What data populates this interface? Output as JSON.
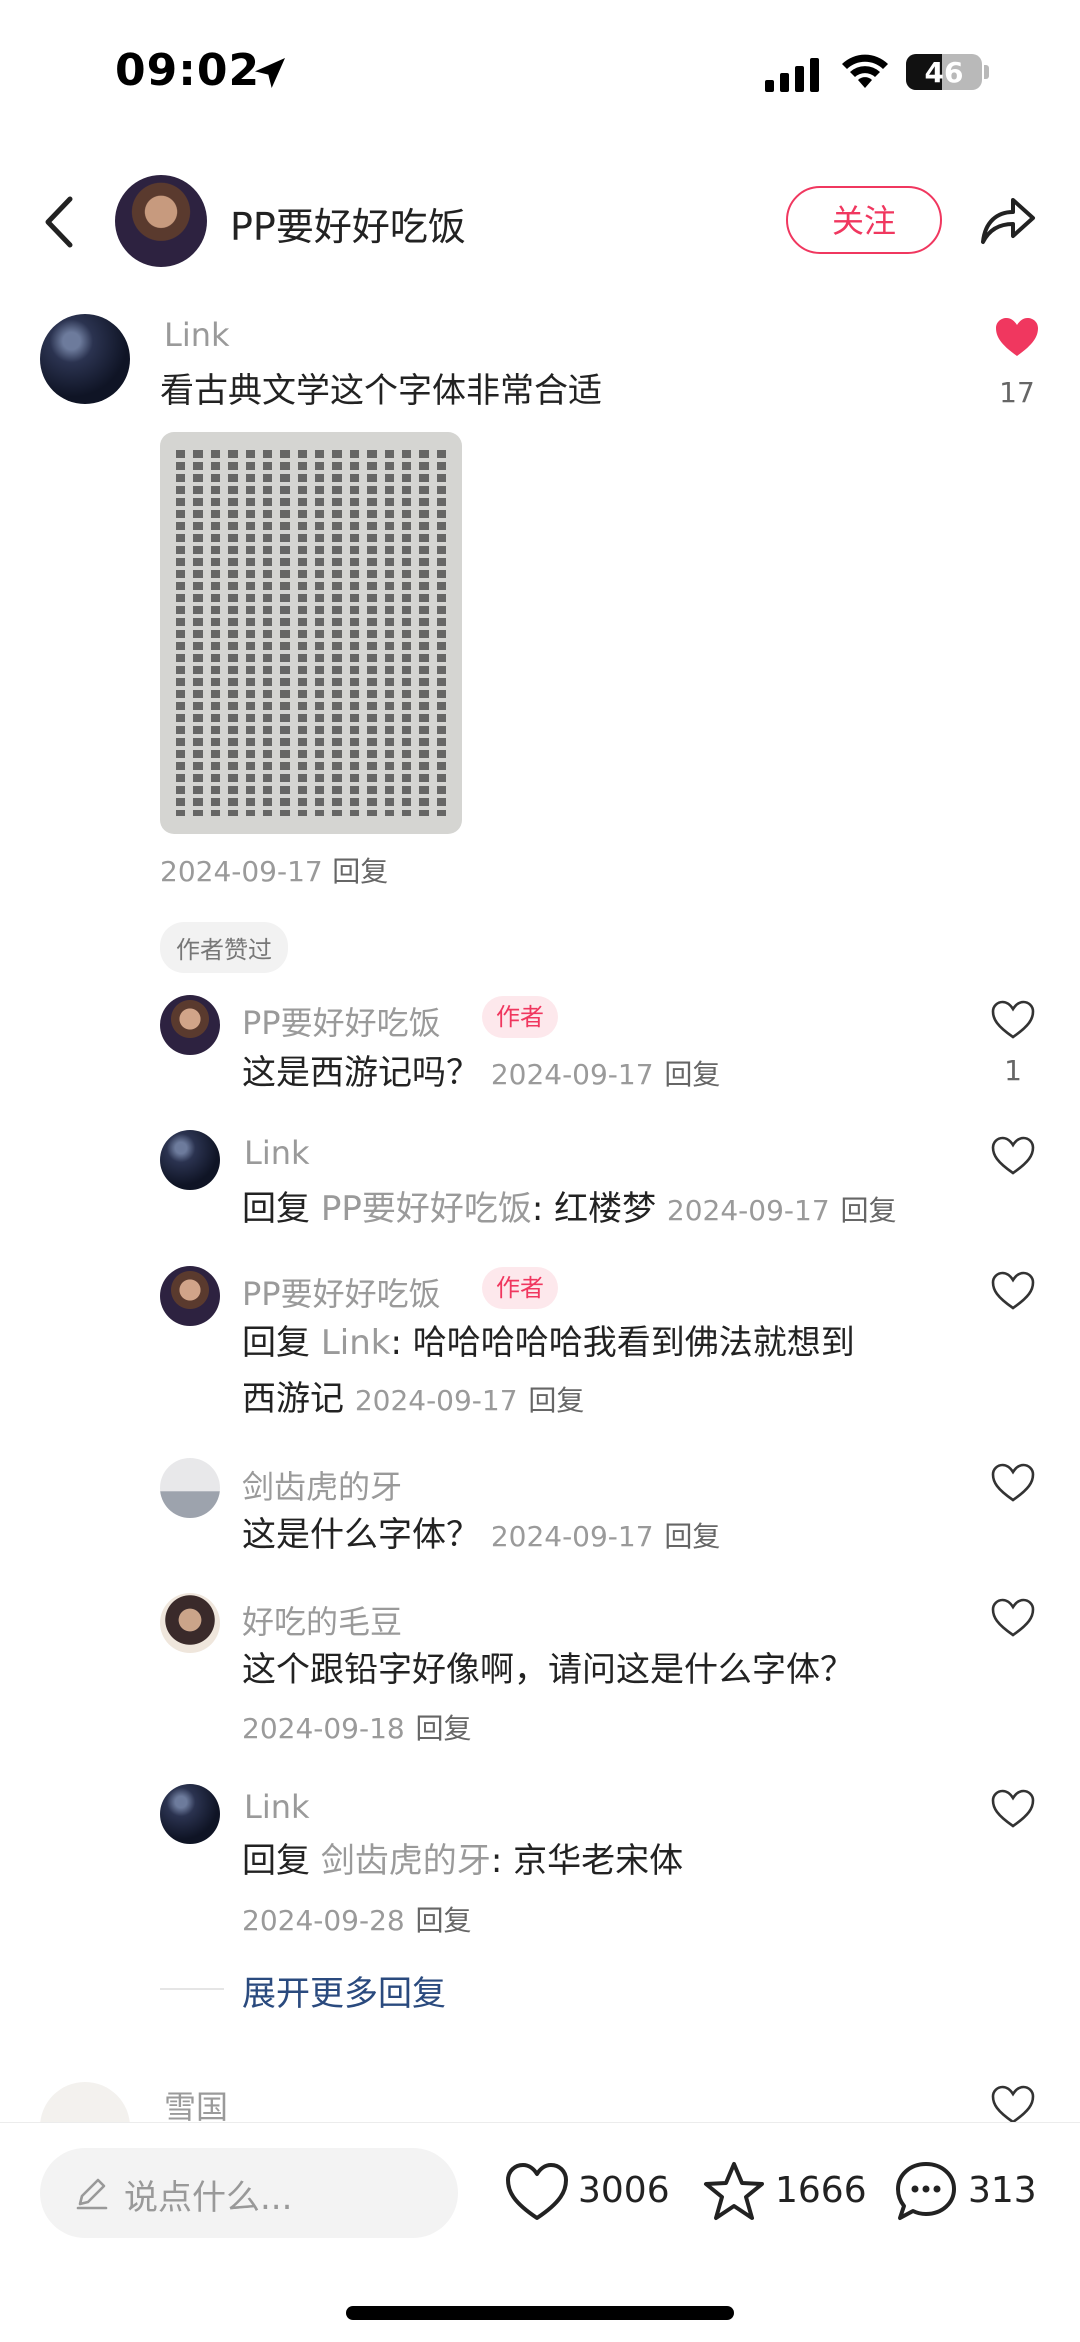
{
  "status": {
    "time": "09:02",
    "battery": "46"
  },
  "header": {
    "author_name": "PP要好好吃饭",
    "follow_label": "关注"
  },
  "main_comment": {
    "user": "Link",
    "text": "看古典文学这个字体非常合适",
    "likes": "17",
    "date": "2024-09-17",
    "reply_label": "回复",
    "liked_chip": "作者赞过"
  },
  "replies": [
    {
      "user": "PP要好好吃饭",
      "author_tag": "作者",
      "text": "这是西游记吗？",
      "date": "2024-09-17",
      "reply_label": "回复",
      "likes": "1"
    },
    {
      "user": "Link",
      "reply_prefix": "回复",
      "reply_to": "PP要好好吃饭",
      "text": "红楼梦",
      "date": "2024-09-17",
      "reply_label": "回复"
    },
    {
      "user": "PP要好好吃饭",
      "author_tag": "作者",
      "reply_prefix": "回复",
      "reply_to": "Link",
      "text_line1": "哈哈哈哈哈我看到佛法就想到",
      "text_line2": "西游记",
      "date": "2024-09-17",
      "reply_label": "回复"
    },
    {
      "user": "剑齿虎的牙",
      "text": "这是什么字体？",
      "date": "2024-09-17",
      "reply_label": "回复"
    },
    {
      "user": "好吃的毛豆",
      "text": "这个跟铅字好像啊，请问这是什么字体？",
      "date": "2024-09-18",
      "reply_label": "回复"
    },
    {
      "user": "Link",
      "reply_prefix": "回复",
      "reply_to": "剑齿虎的牙",
      "text": "京华老宋体",
      "date": "2024-09-28",
      "reply_label": "回复"
    }
  ],
  "expand_label": "展开更多回复",
  "next_comment": {
    "user": "雪国"
  },
  "bottom": {
    "placeholder": "说点什么...",
    "likes": "3006",
    "stars": "1666",
    "comments": "313"
  },
  "colors": {
    "accent": "#f0375f",
    "link": "#2a4a7e"
  }
}
